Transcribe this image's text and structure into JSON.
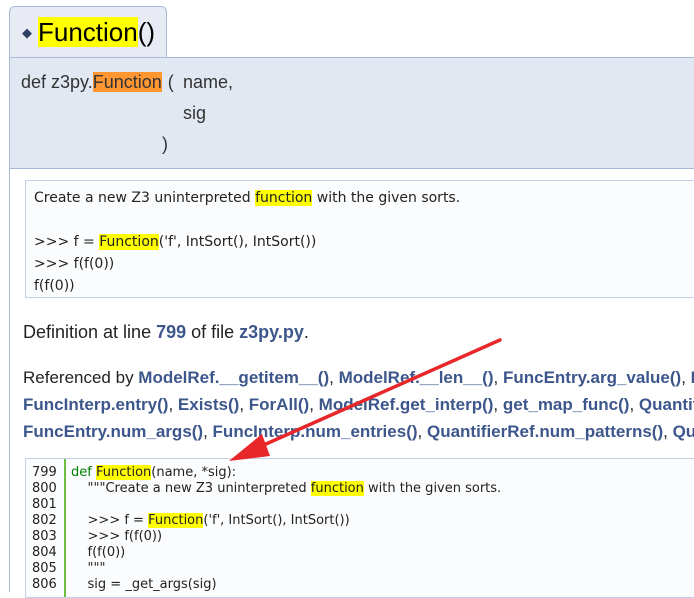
{
  "header": {
    "title_name": "Function",
    "title_parens": "()"
  },
  "prototype": {
    "prefix": "def z3py.",
    "func_name": "Function",
    "open_paren": "(",
    "param1": "name,",
    "param2": "sig",
    "close_paren": ")"
  },
  "docstring": {
    "line1_a": "Create a new Z3 uninterpreted ",
    "line1_hl": "function",
    "line1_b": " with the given sorts.",
    "line2_a": ">>> f = ",
    "line2_hl": "Function",
    "line2_b": "('f', IntSort(), IntSort())",
    "line3": ">>> f(f(0))",
    "line4": "f(f(0))"
  },
  "definition": {
    "prefix": "Definition at line ",
    "line_number": "799",
    "middle": " of file ",
    "file": "z3py.py",
    "suffix": "."
  },
  "references": {
    "label": "Referenced by ",
    "row1": [
      "ModelRef.__getitem__()",
      "ModelRef.__len__()",
      "FuncEntry.arg_value()",
      "Fu"
    ],
    "row2": [
      "FuncInterp.entry()",
      "Exists()",
      "ForAll()",
      "ModelRef.get_interp()",
      "get_map_func()",
      "Quantifi"
    ],
    "row3": [
      "FuncEntry.num_args()",
      "FuncInterp.num_entries()",
      "QuantifierRef.num_patterns()",
      "Qua"
    ]
  },
  "code": {
    "line_numbers": [
      "799",
      "800",
      "801",
      "802",
      "803",
      "804",
      "805",
      "806"
    ],
    "l799_kw": "def ",
    "l799_hl": "Function",
    "l799_rest": "(name, *sig):",
    "l800_a": "    \"\"\"Create a new Z3 uninterpreted ",
    "l800_hl": "function",
    "l800_b": " with the given sorts.",
    "l801": "",
    "l802_a": "    >>> f = ",
    "l802_hl": "Function",
    "l802_b": "('f', IntSort(), IntSort())",
    "l803": "    >>> f(f(0))",
    "l804": "    f(f(0))",
    "l805": "    \"\"\"",
    "l806": "    sig = _get_args(sig)"
  },
  "annotation": {
    "arrow_color": "#e8272a"
  }
}
